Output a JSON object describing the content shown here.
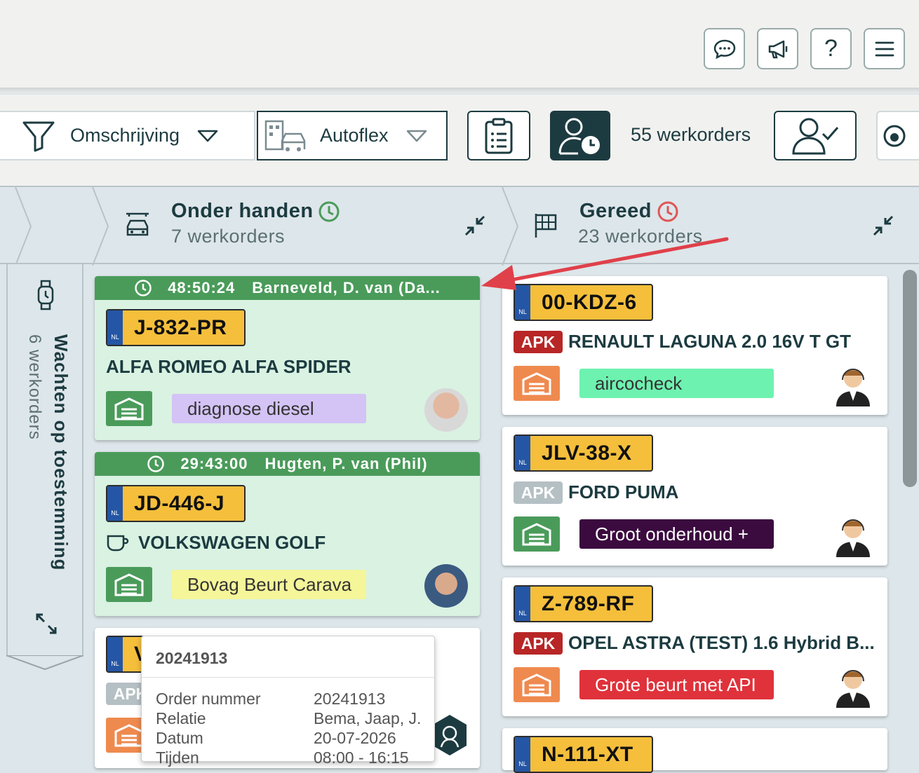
{
  "header": {
    "buttons": [
      {
        "name": "chat",
        "icon": "chat-bubble-icon"
      },
      {
        "name": "announcements",
        "icon": "megaphone-icon"
      },
      {
        "name": "help",
        "icon": "question-icon",
        "label": "?"
      },
      {
        "name": "menu",
        "icon": "hamburger-icon"
      }
    ]
  },
  "filters": {
    "description_label": "Omschrijving",
    "location_label": "Autoflex",
    "order_count": "55 werkorders"
  },
  "columns": {
    "waiting": {
      "title": "Wachten op toestemming",
      "count": "6 werkorders"
    },
    "in_progress": {
      "title": "Onder handen",
      "count": "7 werkorders",
      "clock_color": "#4a9b5a"
    },
    "done": {
      "title": "Gereed",
      "count": "23 werkorders",
      "clock_color": "#e05555"
    }
  },
  "in_progress_cards": [
    {
      "timer": "48:50:24",
      "mechanic": "Barneveld, D. van (Da...",
      "plate": "J-832-PR",
      "country": "NL",
      "model": "ALFA ROMEO ALFA SPIDER",
      "tag": "diagnose diesel",
      "tag_color": "#d4c3f5"
    },
    {
      "timer": "29:43:00",
      "mechanic": "Hugten, P. van (Phil)",
      "plate": "JD-446-J",
      "country": "NL",
      "model": "VOLKSWAGEN GOLF",
      "tag": "Bovag Beurt Carava",
      "tag_color": "#f5f59a"
    },
    {
      "plate_partial": "V",
      "country": "NL",
      "badge_partial": "APK"
    }
  ],
  "done_cards": [
    {
      "plate": "00-KDZ-6",
      "country": "NL",
      "badge": "APK",
      "badge_color": "#b82626",
      "model": "RENAULT LAGUNA 2.0 16V T GT",
      "tag": "aircocheck",
      "tag_color": "#6ef2b0",
      "garage_color": "#ef8a4f"
    },
    {
      "plate": "JLV-38-X",
      "country": "NL",
      "badge": "APK",
      "badge_color": "#b5c0c4",
      "model": "FORD PUMA",
      "tag": "Groot onderhoud + ",
      "tag_color": "#3b0a3f",
      "garage_color": "#4a9b5a"
    },
    {
      "plate": "Z-789-RF",
      "country": "NL",
      "badge": "APK",
      "badge_color": "#b82626",
      "model": "OPEL ASTRA (TEST) 1.6 Hybrid B...",
      "tag": "Grote beurt met API",
      "tag_color": "#e0323b",
      "garage_color": "#ef8a4f"
    },
    {
      "plate": "N-111-XT",
      "country": "NL"
    }
  ],
  "popup": {
    "title": "20241913",
    "rows": [
      {
        "label": "Order nummer",
        "value": "20241913"
      },
      {
        "label": "Relatie",
        "value": "Bema, Jaap, J."
      },
      {
        "label": "Datum",
        "value": "20-07-2026"
      },
      {
        "label": "Tijden",
        "value": "08:00 - 16:15"
      }
    ]
  }
}
